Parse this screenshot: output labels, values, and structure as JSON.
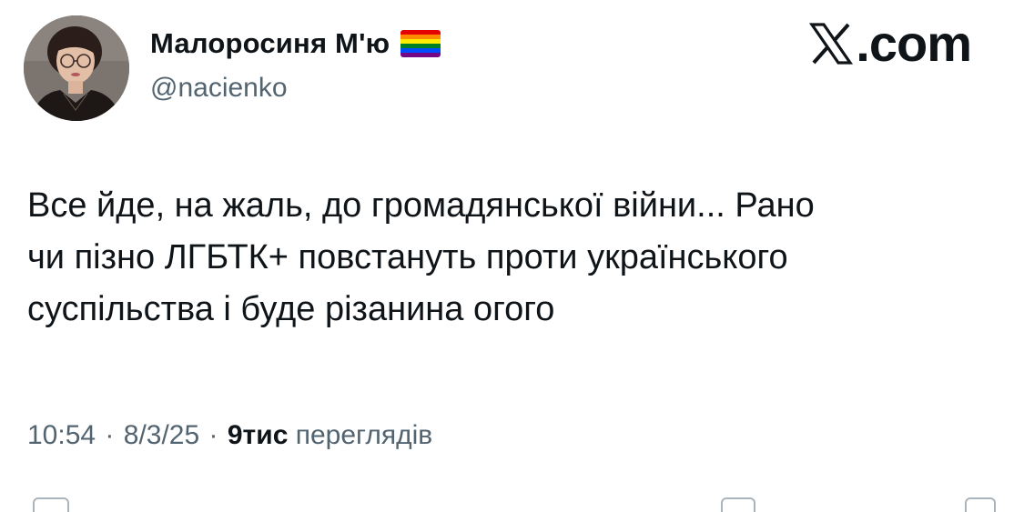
{
  "author": {
    "display_name": "Малоросиня М'ю",
    "handle": "@nacienko",
    "flag_icon": "rainbow-flag-icon",
    "avatar": "profile-photo"
  },
  "brand": {
    "logo_icon": "x-logo-icon",
    "text": ".com"
  },
  "tweet": {
    "lines": [
      "Все йде, на жаль, до громадянської війни... Рано",
      "чи пізно ЛГБТК+ повстануть проти українського",
      "суспільства і буде різанина огого"
    ]
  },
  "meta": {
    "time": "10:54",
    "separator": "·",
    "date": "8/3/25",
    "views_count": "9тис",
    "views_label": "переглядів"
  },
  "colors": {
    "text": "#0f1419",
    "secondary": "#536471",
    "background": "#ffffff"
  }
}
